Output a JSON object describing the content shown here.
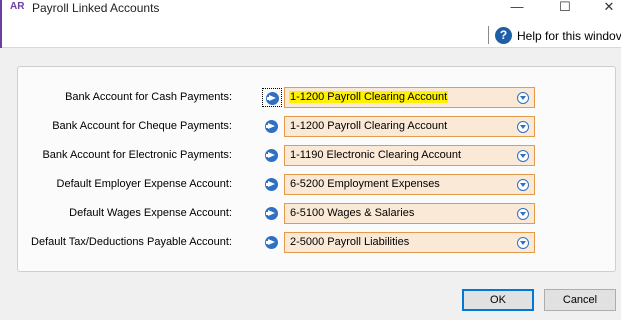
{
  "window": {
    "app_badge": "AR",
    "title": "Payroll Linked Accounts",
    "minimize_glyph": "—",
    "maximize_glyph": "☐",
    "close_glyph": "✕"
  },
  "help": {
    "icon_glyph": "?",
    "label": "Help for this windov"
  },
  "rows": [
    {
      "label": "Bank Account for Cash Payments:",
      "value": "1-1200 Payroll Clearing Account",
      "highlighted": true
    },
    {
      "label": "Bank Account for Cheque Payments:",
      "value": "1-1200 Payroll Clearing Account"
    },
    {
      "label": "Bank Account for Electronic Payments:",
      "value": "1-1190 Electronic Clearing Account"
    },
    {
      "label": "Default Employer Expense Account:",
      "value": "6-5200 Employment Expenses"
    },
    {
      "label": "Default Wages Expense Account:",
      "value": "6-5100 Wages & Salaries"
    },
    {
      "label": "Default Tax/Deductions Payable Account:",
      "value": "2-5000 Payroll Liabilities"
    }
  ],
  "colors": {
    "combo_background": "#fbe9d7",
    "combo_border": "#e39a4a",
    "highlight": "#fff200",
    "arrow_icon": "#2f6fc4",
    "app_badge": "#6b3fa0"
  },
  "icons": {
    "row_link": "arrow-right-circle-icon",
    "combo_dropdown": "chevron-down-circle-icon",
    "help": "help-circle-icon"
  },
  "buttons": {
    "ok": "OK",
    "cancel": "Cancel"
  }
}
